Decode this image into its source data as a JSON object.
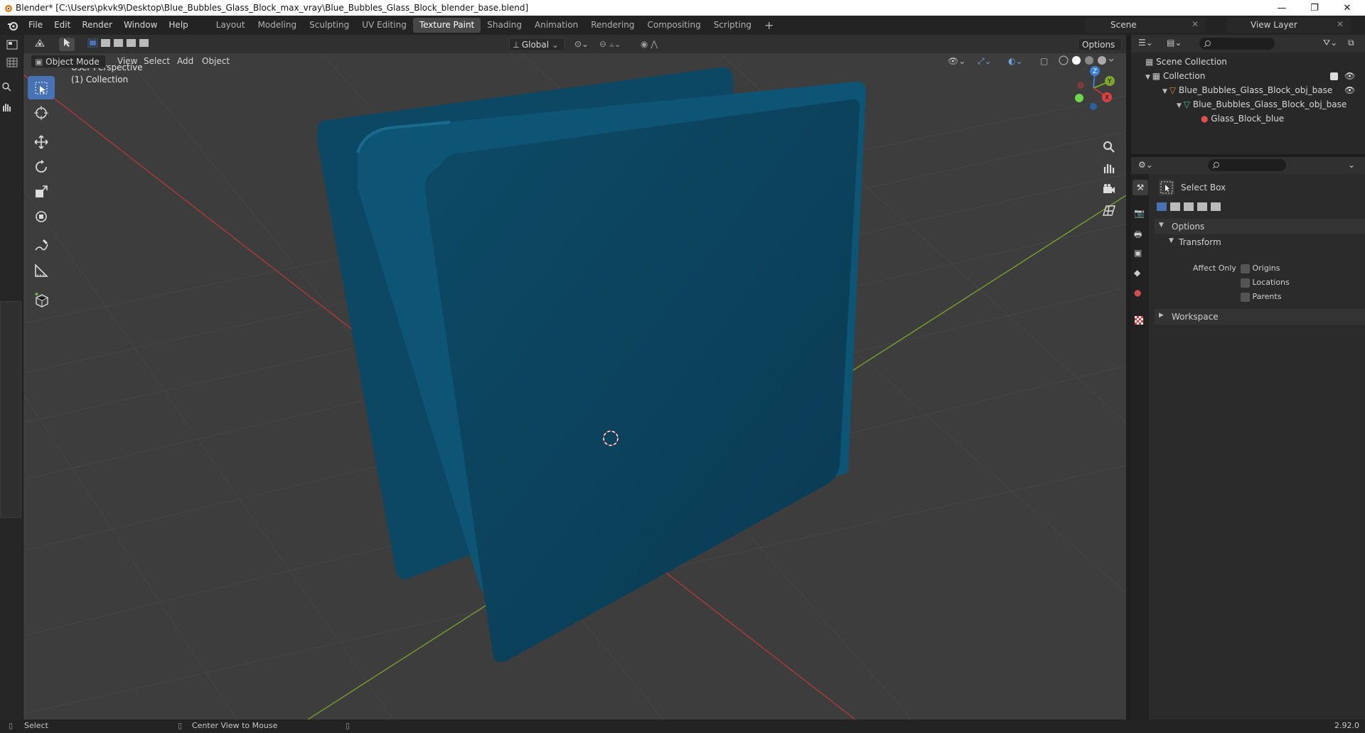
{
  "window": {
    "title": "Blender* [C:\\Users\\pkvk9\\Desktop\\Blue_Bubbles_Glass_Block_max_vray\\Blue_Bubbles_Glass_Block_blender_base.blend]",
    "minimize": "—",
    "maximize": "❐",
    "close": "✕"
  },
  "menu": [
    "File",
    "Edit",
    "Render",
    "Window",
    "Help"
  ],
  "workspaces": [
    "Layout",
    "Modeling",
    "Sculpting",
    "UV Editing",
    "Texture Paint",
    "Shading",
    "Animation",
    "Rendering",
    "Compositing",
    "Scripting"
  ],
  "active_workspace": "Texture Paint",
  "add_workspace": "+",
  "scene": {
    "label": "Scene",
    "view_layer": "View Layer"
  },
  "viewport_header": {
    "mode": "Object Mode",
    "menus": [
      "View",
      "Select",
      "Add",
      "Object"
    ],
    "orientation": "Global",
    "options": "Options"
  },
  "viewport": {
    "perspective": "User Perspective",
    "collection": "(1) Collection",
    "gizmo": {
      "z": "Z",
      "y": "Y",
      "x": "X"
    },
    "object_color": "#0b4a66"
  },
  "outliner": {
    "scene_collection": "Scene Collection",
    "collection": "Collection",
    "object": "Blue_Bubbles_Glass_Block_obj_base",
    "mesh": "Blue_Bubbles_Glass_Block_obj_base",
    "material": "Glass_Block_blue"
  },
  "properties": {
    "tool_name": "Select Box",
    "options_panel": "Options",
    "transform_panel": "Transform",
    "affect_only_label": "Affect Only",
    "affect_only": [
      {
        "label": "Origins",
        "checked": false
      },
      {
        "label": "Locations",
        "checked": false
      },
      {
        "label": "Parents",
        "checked": false
      }
    ],
    "workspace_panel": "Workspace"
  },
  "statusbar": {
    "left": "Select",
    "middle": "Center View to Mouse",
    "version": "2.92.0"
  },
  "colors": {
    "accent": "#4772b3",
    "x_axis": "#b53a3a",
    "y_axis": "#7da62b",
    "z_axis": "#3b7fd6"
  }
}
